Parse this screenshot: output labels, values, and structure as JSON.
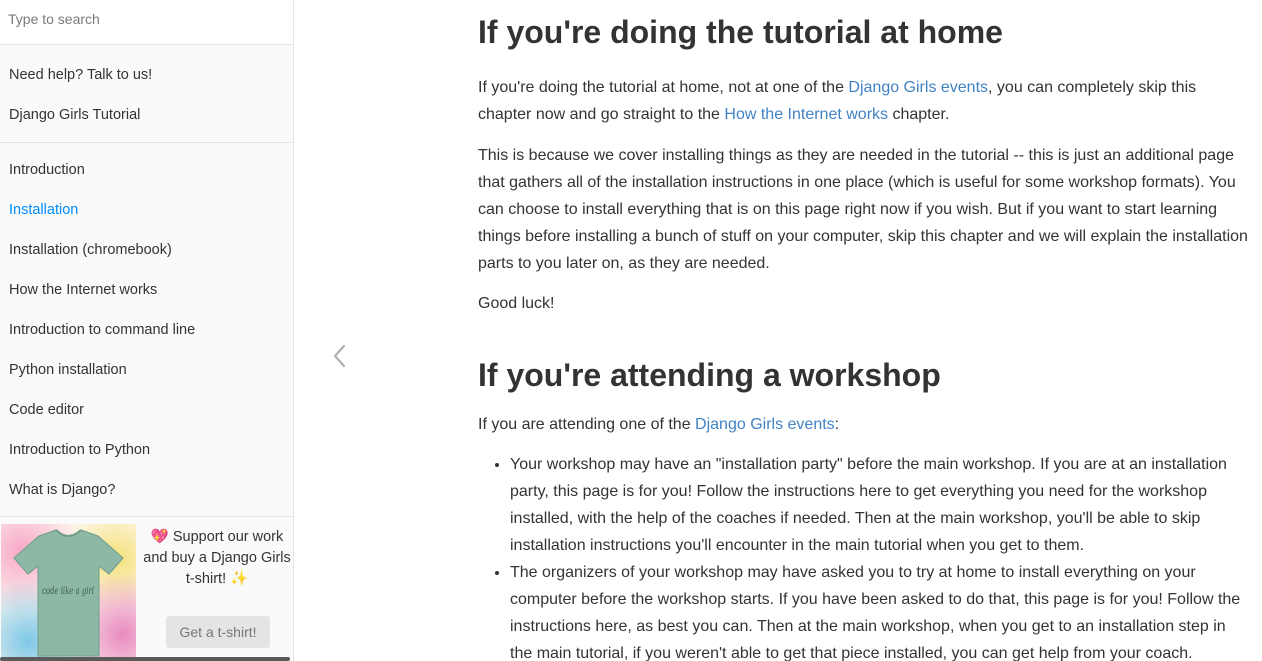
{
  "search": {
    "placeholder": "Type to search"
  },
  "sidebar": {
    "top_items": [
      {
        "label": "Need help? Talk to us!"
      },
      {
        "label": "Django Girls Tutorial"
      }
    ],
    "chapters": [
      {
        "label": "Introduction",
        "active": false
      },
      {
        "label": "Installation",
        "active": true
      },
      {
        "label": "Installation (chromebook)",
        "active": false
      },
      {
        "label": "How the Internet works",
        "active": false
      },
      {
        "label": "Introduction to command line",
        "active": false
      },
      {
        "label": "Python installation",
        "active": false
      },
      {
        "label": "Code editor",
        "active": false
      },
      {
        "label": "Introduction to Python",
        "active": false
      },
      {
        "label": "What is Django?",
        "active": false
      }
    ],
    "promo": {
      "text": "💖 Support our work and buy a Django Girls t-shirt! ✨",
      "button": "Get a t-shirt!",
      "shirt_text": "code like a girl"
    }
  },
  "nav": {
    "prev_icon": "chevron-left-icon"
  },
  "content": {
    "section1": {
      "heading": "If you're doing the tutorial at home",
      "p1": {
        "t1": "If you're doing the tutorial at home, not at one of the ",
        "link1": "Django Girls events",
        "t2": ", you can completely skip this chapter now and go straight to the ",
        "link2": "How the Internet works",
        "t3": " chapter."
      },
      "p2": "This is because we cover installing things as they are needed in the tutorial -- this is just an additional page that gathers all of the installation instructions in one place (which is useful for some workshop formats). You can choose to install everything that is on this page right now if you wish. But if you want to start learning things before installing a bunch of stuff on your computer, skip this chapter and we will explain the installation parts to you later on, as they are needed.",
      "p3": "Good luck!"
    },
    "section2": {
      "heading": "If you're attending a workshop",
      "p1": {
        "t1": "If you are attending one of the ",
        "link1": "Django Girls events",
        "t2": ":"
      },
      "bullets": [
        "Your workshop may have an \"installation party\" before the main workshop. If you are at an installation party, this page is for you! Follow the instructions here to get everything you need for the workshop installed, with the help of the coaches if needed. Then at the main workshop, you'll be able to skip installation instructions you'll encounter in the main tutorial when you get to them.",
        "The organizers of your workshop may have asked you to try at home to install everything on your computer before the workshop starts. If you have been asked to do that, this page is for you! Follow the instructions here, as best you can. Then at the main workshop, when you get to an installation step in the main tutorial, if you weren't able to get that piece installed, you can get help from your coach."
      ]
    }
  },
  "colors": {
    "link": "#4183c4",
    "active_nav": "#008cff",
    "sidebar_bg": "#fafafa"
  }
}
